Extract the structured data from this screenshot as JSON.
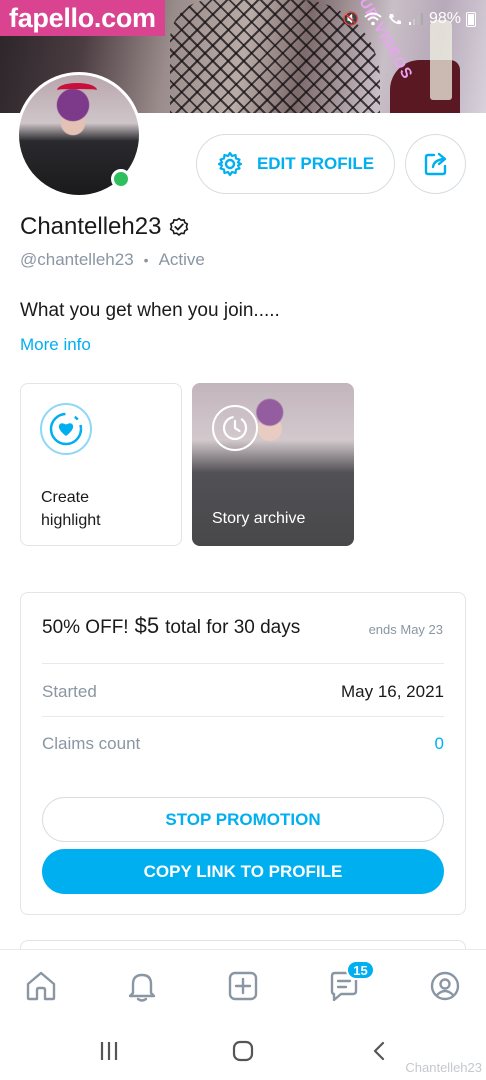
{
  "site_badge": "fapello.com",
  "status_bar": {
    "battery": "98%"
  },
  "cover": {
    "watermark_text": "UR VIDEOS"
  },
  "profile": {
    "name": "Chantelleh23",
    "handle": "@chantelleh23",
    "separator": "•",
    "status": "Active",
    "edit_button": "EDIT PROFILE",
    "bio": "What you get when you join.....",
    "more_info": "More info"
  },
  "highlights": {
    "create_label": "Create highlight",
    "archive_label": "Story archive"
  },
  "promotion": {
    "title_prefix": "50% OFF!",
    "price": "$5",
    "title_suffix": "total for 30 days",
    "ends": "ends May 23",
    "rows": [
      {
        "label": "Started",
        "value": "May 16, 2021"
      },
      {
        "label": "Claims count",
        "value": "0"
      }
    ],
    "stop_button": "STOP PROMOTION",
    "copy_button": "COPY LINK TO PROFILE"
  },
  "bottom_nav": {
    "messages_badge": "15",
    "items": [
      "home-icon",
      "bell-icon",
      "add-post-icon",
      "messages-icon",
      "profile-icon"
    ]
  },
  "watermark": "Chantelleh23",
  "colors": {
    "accent": "#00aff0",
    "online": "#2fbf5c",
    "badge_bg": "#d9438f"
  }
}
